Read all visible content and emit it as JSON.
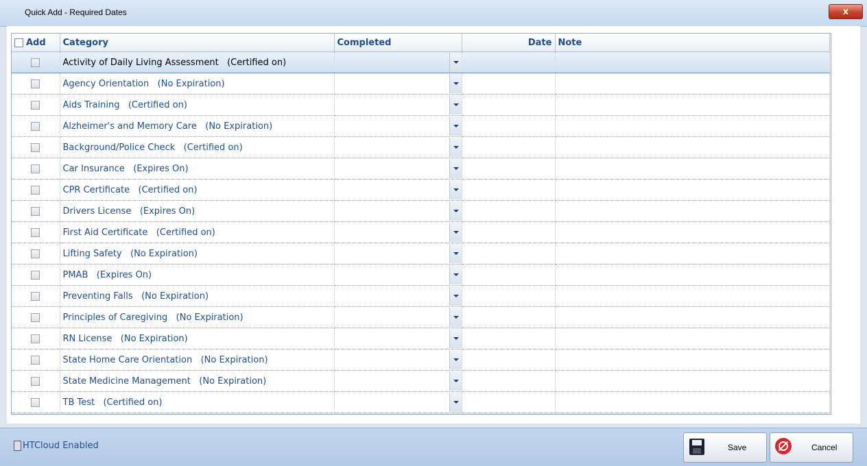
{
  "window": {
    "title": "Quick Add - Required Dates",
    "close_label": "x"
  },
  "grid": {
    "columns": [
      "Add",
      "Category",
      "Completed",
      "Date",
      "Note"
    ],
    "rows": [
      {
        "category": "Activity of Daily Living Assessment   (Certified on)",
        "selected": true
      },
      {
        "category": "Agency Orientation   (No Expiration)"
      },
      {
        "category": "Aids Training   (Certified on)"
      },
      {
        "category": "Alzheimer's and Memory Care   (No Expiration)"
      },
      {
        "category": "Background/Police Check   (Certified on)"
      },
      {
        "category": "Car Insurance   (Expires On)"
      },
      {
        "category": "CPR Certificate   (Certified on)"
      },
      {
        "category": "Drivers License   (Expires On)"
      },
      {
        "category": "First Aid Certificate   (Certified on)"
      },
      {
        "category": "Lifting Safety   (No Expiration)"
      },
      {
        "category": "PMAB   (Expires On)"
      },
      {
        "category": "Preventing Falls   (No Expiration)"
      },
      {
        "category": "Principles of Caregiving   (No Expiration)"
      },
      {
        "category": "RN License   (No Expiration)"
      },
      {
        "category": "State Home Care Orientation   (No Expiration)"
      },
      {
        "category": "State Medicine Management   (No Expiration)"
      },
      {
        "category": "TB Test   (Certified on)"
      }
    ]
  },
  "status": {
    "cloud_label": "HTCloud Enabled"
  },
  "buttons": {
    "save_label": "Save",
    "cancel_label": "Cancel"
  },
  "colors": {
    "accent_text": "#1f4e8c",
    "close_button": "#c9432f",
    "statusbar": "#b3c9e6"
  }
}
